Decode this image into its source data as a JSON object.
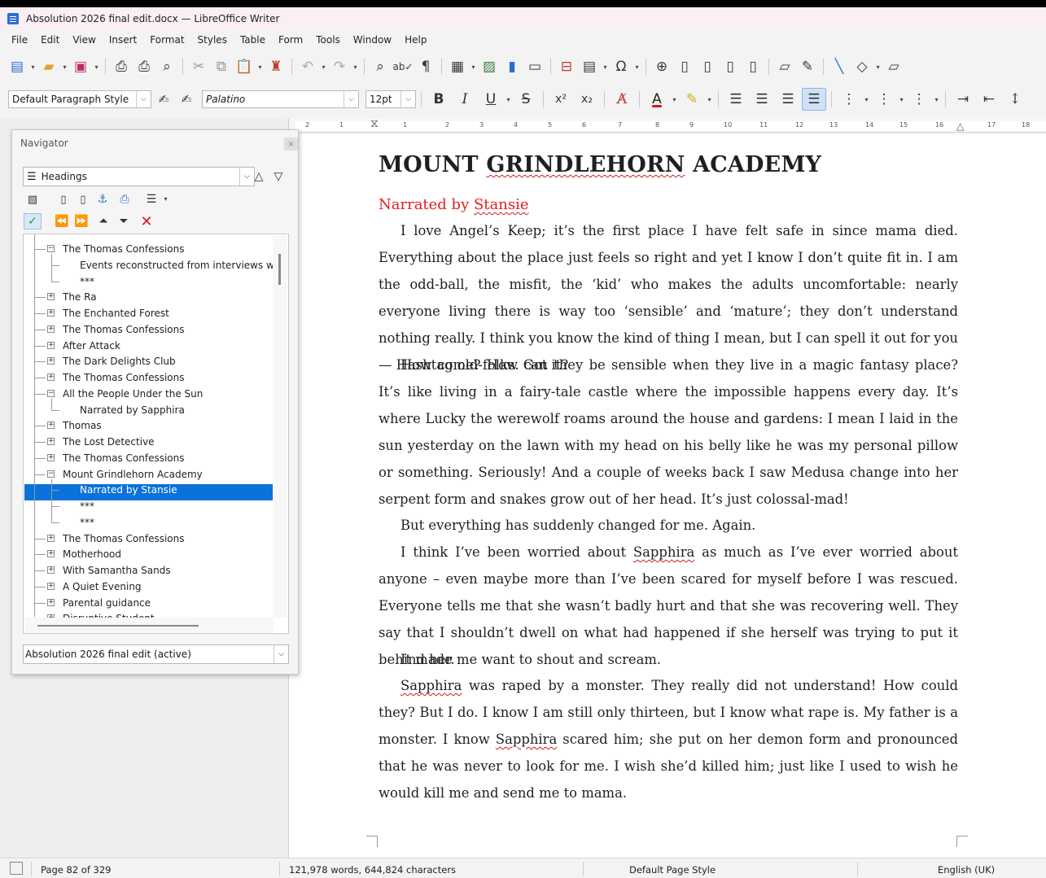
{
  "window": {
    "title": "Absolution 2026 final edit.docx — LibreOffice Writer"
  },
  "menu": [
    "File",
    "Edit",
    "View",
    "Insert",
    "Format",
    "Styles",
    "Table",
    "Form",
    "Tools",
    "Window",
    "Help"
  ],
  "formatting": {
    "paragraph_style": "Default Paragraph Style",
    "font_name": "Palatino",
    "font_size": "12pt",
    "bold": "B",
    "italic": "I",
    "underline": "U",
    "strike": "S",
    "superscript": "x²",
    "subscript": "x₂"
  },
  "colors": {
    "accent": "#0a72d8",
    "heading_red": "#e21d1d",
    "spell_red": "#d01b1b"
  },
  "ruler": {
    "ticks": [
      "2",
      "1",
      "1",
      "2",
      "3",
      "4",
      "5",
      "6",
      "7",
      "8",
      "9",
      "10",
      "11",
      "12",
      "13",
      "14",
      "15",
      "16",
      "17",
      "18"
    ]
  },
  "navigator": {
    "title": "Navigator",
    "category": "Headings",
    "document": "Absolution 2026 final edit (active)",
    "tree": [
      {
        "label": "The Thomas Confessions",
        "level": 1,
        "expanded": true
      },
      {
        "label": "Events reconstructed from interviews with Je",
        "level": 2
      },
      {
        "label": "***",
        "level": 2
      },
      {
        "label": "The Ra",
        "level": 1,
        "expanded": false
      },
      {
        "label": "The Enchanted Forest",
        "level": 1,
        "expanded": false
      },
      {
        "label": "The Thomas Confessions",
        "level": 1,
        "expanded": false
      },
      {
        "label": "After Attack",
        "level": 1,
        "expanded": false
      },
      {
        "label": "The Dark Delights Club",
        "level": 1,
        "expanded": false
      },
      {
        "label": "The Thomas Confessions",
        "level": 1,
        "expanded": false
      },
      {
        "label": "All the People Under the Sun",
        "level": 1,
        "expanded": true
      },
      {
        "label": "Narrated by Sapphira",
        "level": 2
      },
      {
        "label": "Thomas",
        "level": 1,
        "expanded": false
      },
      {
        "label": "The Lost Detective",
        "level": 1,
        "expanded": false
      },
      {
        "label": "The Thomas Confessions",
        "level": 1,
        "expanded": false
      },
      {
        "label": "Mount Grindlehorn Academy",
        "level": 1,
        "expanded": true
      },
      {
        "label": "Narrated by Stansie",
        "level": 2,
        "selected": true
      },
      {
        "label": "***",
        "level": 2
      },
      {
        "label": "***",
        "level": 2
      },
      {
        "label": "The Thomas Confessions",
        "level": 1,
        "expanded": false
      },
      {
        "label": "Motherhood",
        "level": 1,
        "expanded": false
      },
      {
        "label": "With Samantha Sands",
        "level": 1,
        "expanded": false
      },
      {
        "label": "A Quiet Evening",
        "level": 1,
        "expanded": false
      },
      {
        "label": "Parental guidance",
        "level": 1,
        "expanded": false
      },
      {
        "label": "Disruptive Student",
        "level": 1,
        "expanded": false
      }
    ]
  },
  "document": {
    "heading": "MOUNT GRINDLEHORN ACADEMY",
    "subheading": "Narrated by Stansie",
    "paragraphs": [
      "I love Angel’s Keep; it’s the first place I have felt safe in since mama died. Everything about the place just feels so right and yet I know I don’t quite fit in. I am the odd-ball, the misfit, the ‘kid’ who makes the adults uncomfortable: nearly everyone living there is way too ‘sensible’ and ‘mature’; they don’t understand nothing really. I think you know the kind of thing I mean, but I can spell it out for you — Hashtag old-folks. Got it?",
      "How come? How can they be sensible when they live in a magic fantasy place? It’s like living in a fairy-tale castle where the impossible happens every day. It’s where Lucky the werewolf roams around the house and gardens: I mean I laid in the sun yesterday on the lawn with my head on his belly like he was my personal pillow or something. Seriously! And a couple of weeks back I saw Medusa change into her serpent form and snakes grow out of her head. It’s just colossal-mad!",
      "But everything has suddenly changed for me. Again.",
      "I think I’ve been worried about Sapphira as much as I’ve ever worried about anyone – even maybe more than I’ve been scared for myself before I was rescued. Everyone tells me that she wasn’t badly hurt and that she was recovering well. They say that I shouldn’t dwell on what had happened if she herself was trying to put it behind her.",
      "It made me want to shout and scream.",
      "Sapphira was raped by a monster. They really did not understand! How could they? But I do. I know I am still only thirteen, but I know what rape is. My father is a monster. I know Sapphira scared him; she put on her demon form and pronounced that he was never to look for me. I wish she’d killed him; just like I used to wish he would kill me and send me to mama."
    ]
  },
  "status": {
    "page": "Page 82 of 329",
    "words": "121,978 words, 644,824 characters",
    "page_style": "Default Page Style",
    "language": "English (UK)"
  }
}
